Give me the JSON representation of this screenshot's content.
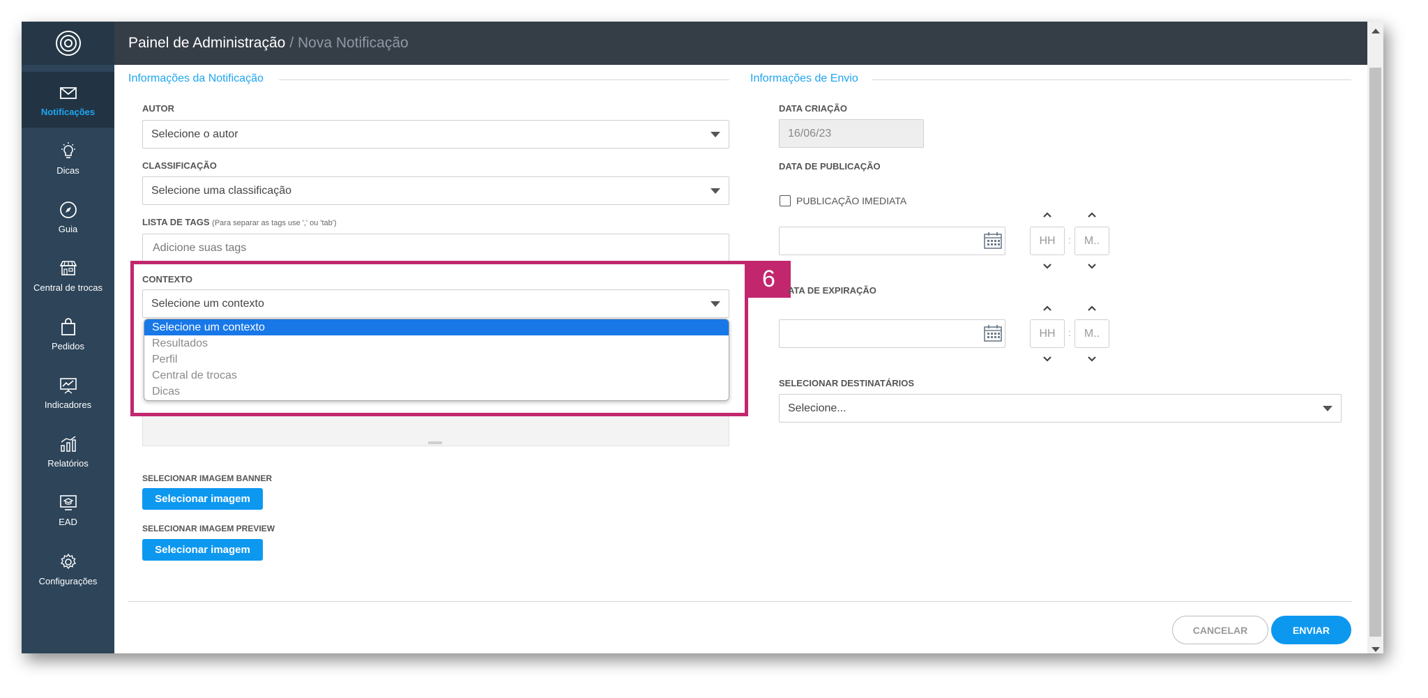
{
  "header": {
    "title": "Painel de Administração",
    "breadcrumb": "/ Nova Notificação"
  },
  "sidebar": {
    "items": [
      {
        "label": "Notificações",
        "icon": "envelope-icon",
        "active": true
      },
      {
        "label": "Dicas",
        "icon": "lightbulb-icon"
      },
      {
        "label": "Guia",
        "icon": "compass-icon"
      },
      {
        "label": "Central de trocas",
        "icon": "store-icon"
      },
      {
        "label": "Pedidos",
        "icon": "shopping-bag-icon"
      },
      {
        "label": "Indicadores",
        "icon": "presentation-chart-icon"
      },
      {
        "label": "Relatórios",
        "icon": "bar-chart-icon"
      },
      {
        "label": "EAD",
        "icon": "graduation-monitor-icon"
      },
      {
        "label": "Configurações",
        "icon": "gear-icon"
      }
    ]
  },
  "left_section": {
    "title": "Informações da Notificação",
    "author": {
      "label": "AUTOR",
      "value": "Selecione o autor"
    },
    "classification": {
      "label": "CLASSIFICAÇÃO",
      "value": "Selecione uma classificação"
    },
    "tags": {
      "label": "LISTA DE TAGS",
      "hint": "(Para separar as tags use ',' ou 'tab')",
      "placeholder": "Adicione suas tags"
    },
    "context": {
      "label": "CONTEXTO",
      "value": "Selecione um contexto",
      "options": [
        "Selecione um contexto",
        "Resultados",
        "Perfil",
        "Central de trocas",
        "Dicas"
      ],
      "selected_index": 0
    },
    "banner": {
      "label": "SELECIONAR IMAGEM BANNER",
      "button": "Selecionar imagem"
    },
    "preview": {
      "label": "SELECIONAR IMAGEM PREVIEW",
      "button": "Selecionar imagem"
    }
  },
  "right_section": {
    "title": "Informações de Envio",
    "creation_date": {
      "label": "DATA CRIAÇÃO",
      "value": "16/06/23"
    },
    "publication": {
      "label": "DATA DE PUBLICAÇÃO",
      "immediate_label": "PUBLICAÇÃO IMEDIATA",
      "hour_placeholder": "HH",
      "minute_placeholder": "M.."
    },
    "expiration": {
      "label": "ATA DE EXPIRAÇÃO",
      "hour_placeholder": "HH",
      "minute_placeholder": "M.."
    },
    "recipients": {
      "label": "SELECIONAR DESTINATÁRIOS",
      "value": "Selecione..."
    }
  },
  "annotation": {
    "step": "6",
    "color": "#c2276e"
  },
  "footer": {
    "cancel": "CANCELAR",
    "send": "ENVIAR"
  },
  "colors": {
    "accent": "#1ea5f0",
    "button": "#0d98f0",
    "sidebar": "#2d4459",
    "topbar": "#353d47",
    "selected_option": "#1878e8"
  }
}
